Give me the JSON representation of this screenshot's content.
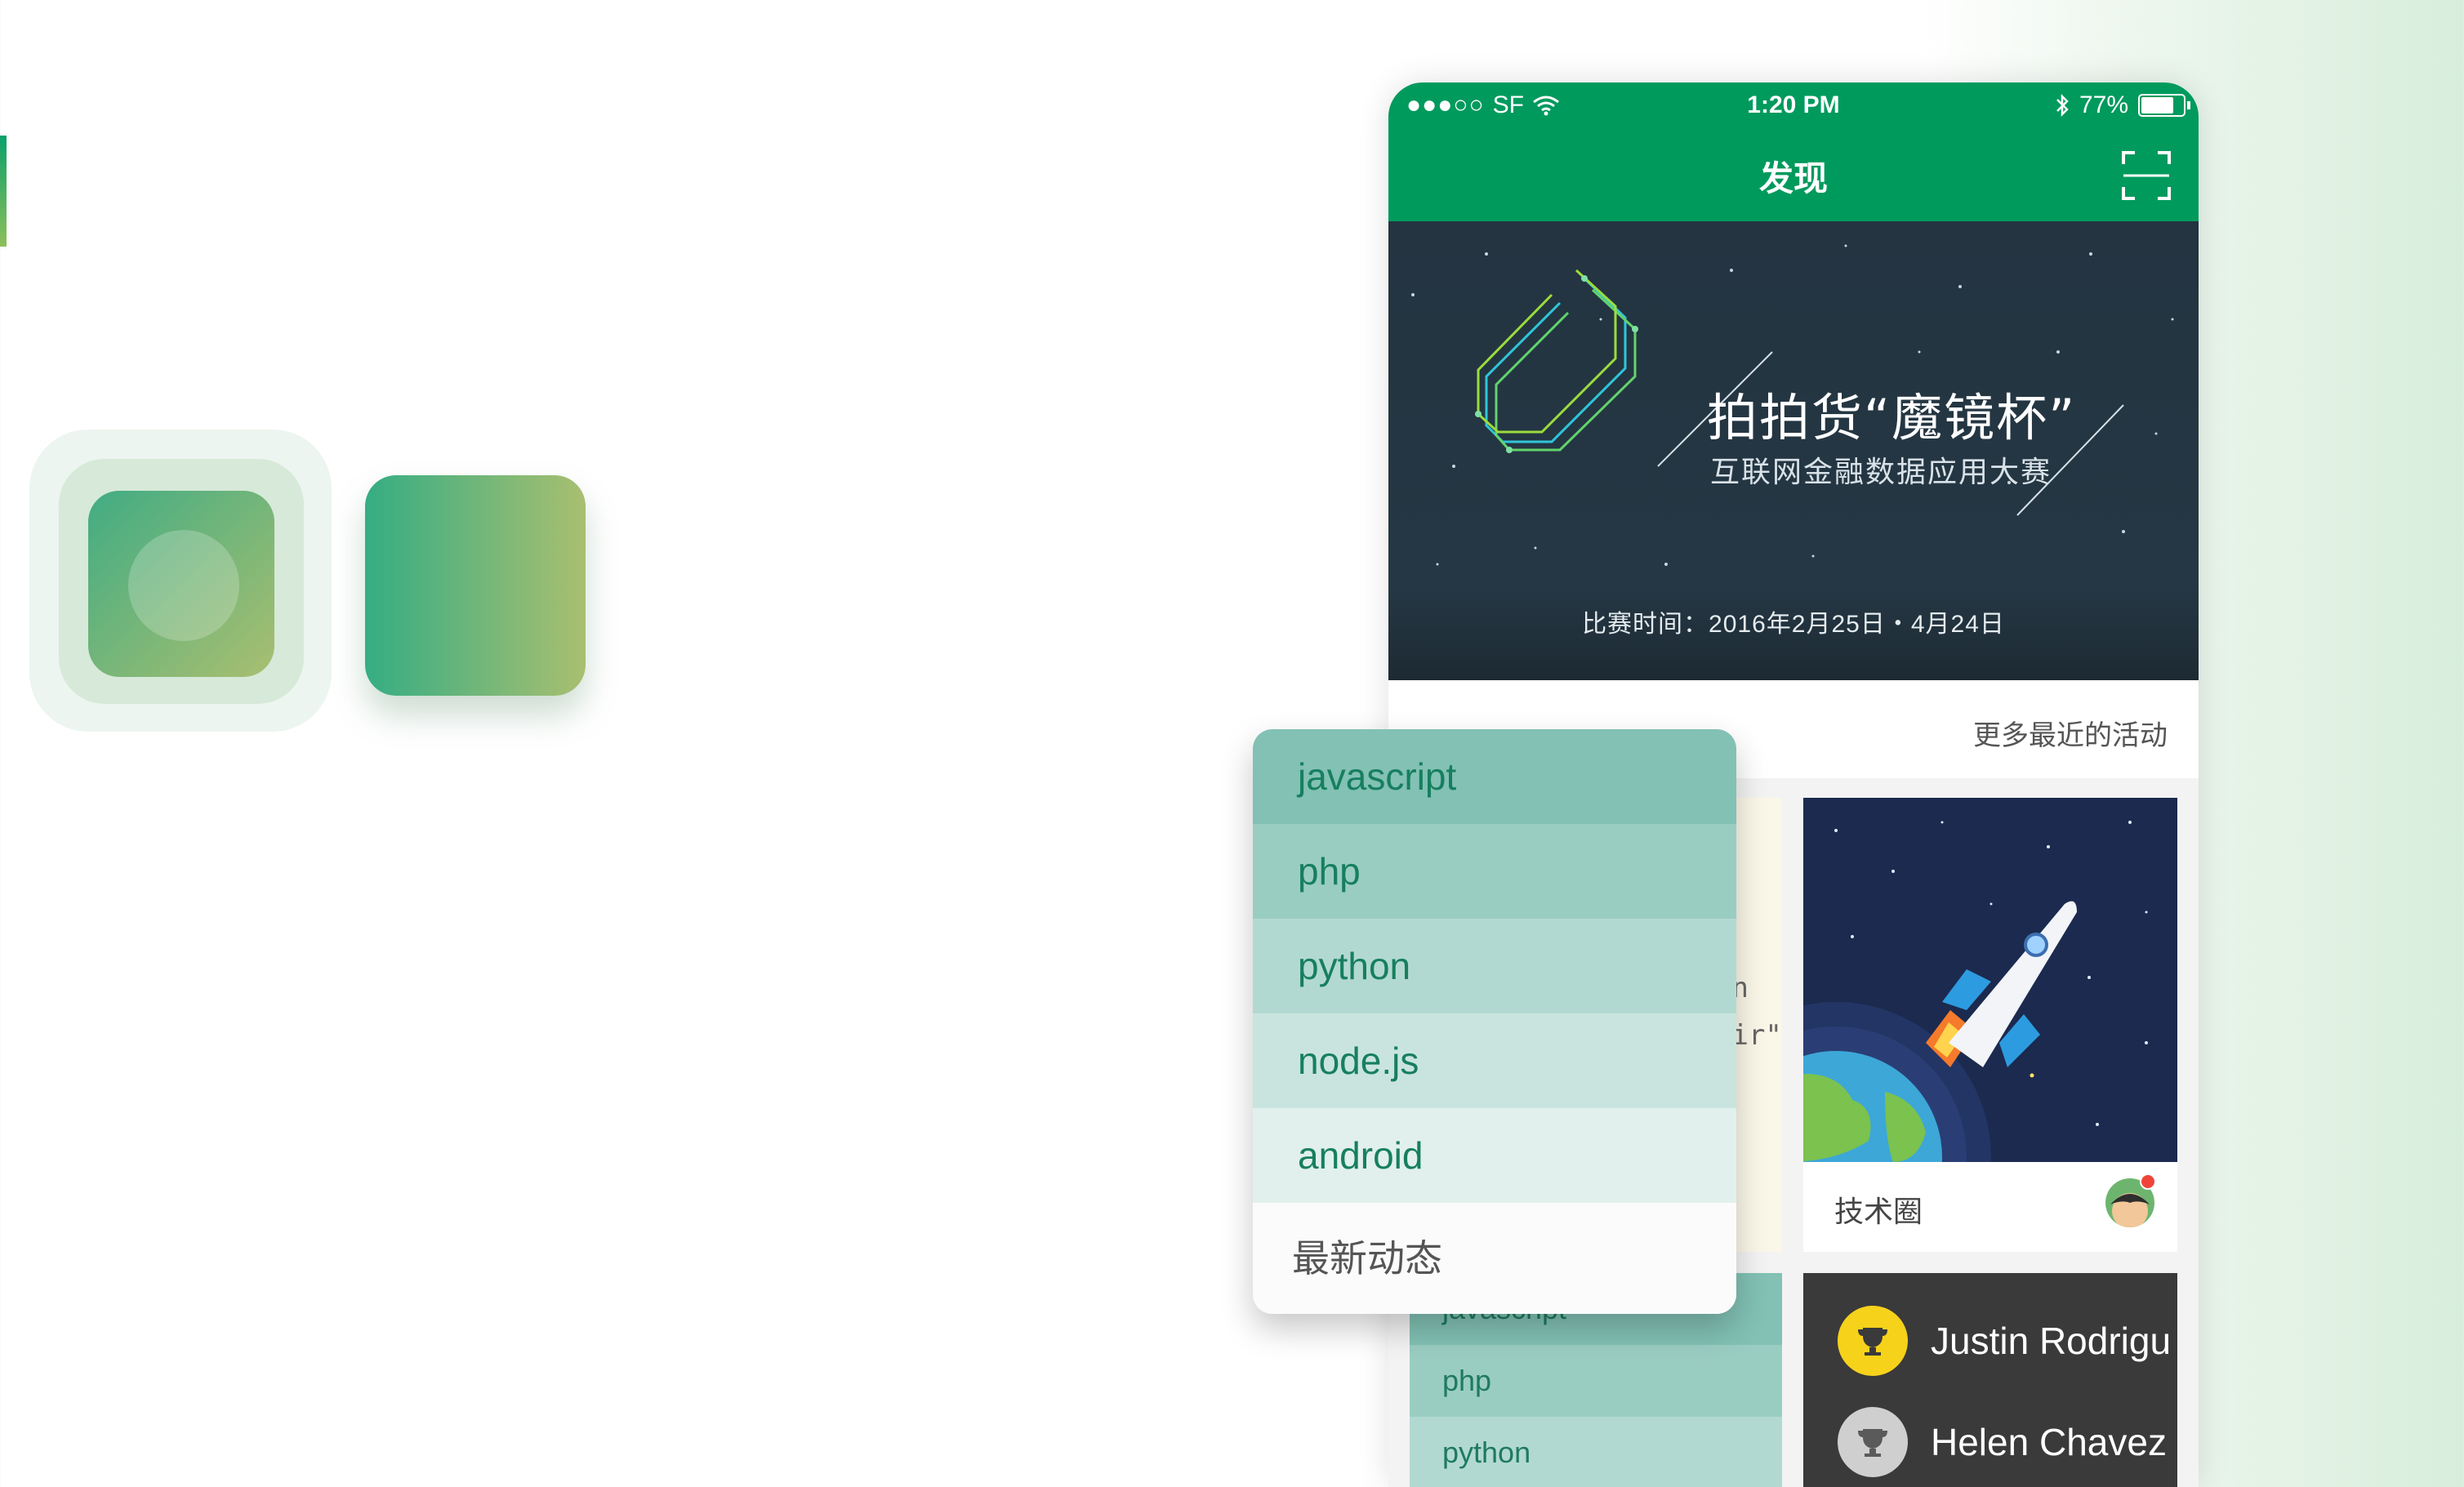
{
  "colors": {
    "brand": "#009a5d",
    "accent_gradient_start": "#35ad83",
    "accent_gradient_end": "#a9bf70"
  },
  "statusbar": {
    "carrier": "SF",
    "time": "1:20 PM",
    "battery_percent": "77%",
    "battery_level": 0.77
  },
  "navbar": {
    "title": "发现",
    "right_icon": "scan-icon"
  },
  "banner": {
    "title": "拍拍货“魔镜杯”",
    "subtitle": "互联网金融数据应用大赛",
    "date": "比赛时间：2016年2月25日・4月24日"
  },
  "more_link": "更多最近的活动",
  "code_card": {
    "fragments": [
      "en",
      "dir\""
    ]
  },
  "tech_card": {
    "label": "技术圈",
    "icon": "rocket-illustration",
    "has_notification": true
  },
  "lang_list_bg": [
    "javascript",
    "php",
    "python"
  ],
  "leaderboard": [
    {
      "name": "Justin Rodrigu",
      "icon": "trophy-icon",
      "color": "#f7d21b"
    },
    {
      "name": "Helen Chavez",
      "icon": "trophy-icon",
      "color": "#cfcfcf"
    }
  ],
  "dropdown": {
    "items": [
      {
        "label": "javascript",
        "bg": "#82c1b4"
      },
      {
        "label": "php",
        "bg": "#9acdc2"
      },
      {
        "label": "python",
        "bg": "#b2d9d1"
      },
      {
        "label": "node.js",
        "bg": "#c9e4de"
      },
      {
        "label": "android",
        "bg": "#e1f0ec"
      }
    ],
    "footer": "最新动态"
  }
}
